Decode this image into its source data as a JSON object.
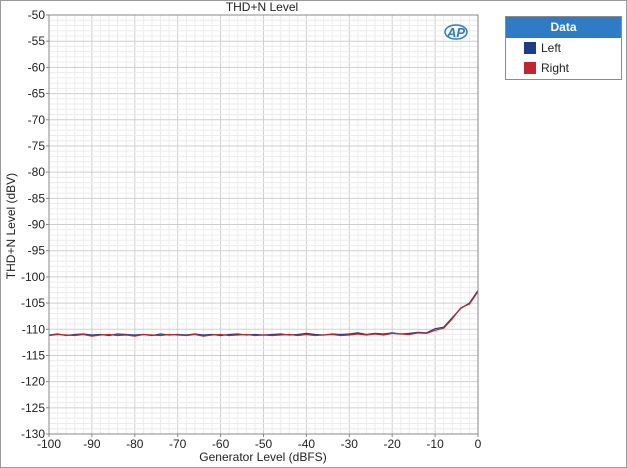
{
  "chart_data": {
    "type": "line",
    "title": "THD+N Level",
    "xlabel": "Generator Level (dBFS)",
    "ylabel": "THD+N Level (dBV)",
    "xlim": [
      -100,
      0
    ],
    "ylim": [
      -130,
      -50
    ],
    "xticks": [
      -100,
      -90,
      -80,
      -70,
      -60,
      -50,
      -40,
      -30,
      -20,
      -10,
      0
    ],
    "yticks": [
      -50,
      -55,
      -60,
      -65,
      -70,
      -75,
      -80,
      -85,
      -90,
      -95,
      -100,
      -105,
      -110,
      -115,
      -120,
      -125,
      -130
    ],
    "grid": true,
    "legend": {
      "title": "Data",
      "placement": "right"
    },
    "logo": "AP",
    "series": [
      {
        "name": "Left",
        "color": "#1f3c88",
        "x": [
          -100,
          -98,
          -96,
          -94,
          -92,
          -90,
          -88,
          -86,
          -84,
          -82,
          -80,
          -78,
          -76,
          -74,
          -72,
          -70,
          -68,
          -66,
          -64,
          -62,
          -60,
          -58,
          -56,
          -54,
          -52,
          -50,
          -48,
          -46,
          -44,
          -42,
          -40,
          -38,
          -36,
          -34,
          -32,
          -30,
          -28,
          -26,
          -24,
          -22,
          -20,
          -18,
          -16,
          -14,
          -12,
          -10,
          -8,
          -6,
          -4,
          -2,
          0
        ],
        "y": [
          -111.1,
          -110.9,
          -111.2,
          -111.0,
          -110.9,
          -111.1,
          -111.0,
          -111.2,
          -110.9,
          -111.0,
          -111.1,
          -111.0,
          -111.2,
          -110.9,
          -111.1,
          -111.0,
          -111.1,
          -110.9,
          -111.1,
          -111.0,
          -111.2,
          -111.0,
          -110.9,
          -111.1,
          -111.0,
          -111.1,
          -111.0,
          -110.9,
          -111.1,
          -111.0,
          -110.8,
          -111.0,
          -111.1,
          -110.9,
          -111.0,
          -110.9,
          -110.7,
          -111.0,
          -110.8,
          -110.9,
          -110.7,
          -110.9,
          -110.8,
          -110.6,
          -110.7,
          -109.9,
          -109.6,
          -107.8,
          -106.0,
          -105.0,
          -102.6
        ]
      },
      {
        "name": "Right",
        "color": "#c0262d",
        "x": [
          -100,
          -98,
          -96,
          -94,
          -92,
          -90,
          -88,
          -86,
          -84,
          -82,
          -80,
          -78,
          -76,
          -74,
          -72,
          -70,
          -68,
          -66,
          -64,
          -62,
          -60,
          -58,
          -56,
          -54,
          -52,
          -50,
          -48,
          -46,
          -44,
          -42,
          -40,
          -38,
          -36,
          -34,
          -32,
          -30,
          -28,
          -26,
          -24,
          -22,
          -20,
          -18,
          -16,
          -14,
          -12,
          -10,
          -8,
          -6,
          -4,
          -2,
          0
        ],
        "y": [
          -111.2,
          -111.0,
          -111.1,
          -111.2,
          -111.0,
          -111.3,
          -111.1,
          -111.0,
          -111.2,
          -111.1,
          -111.3,
          -111.0,
          -111.1,
          -111.2,
          -111.0,
          -111.1,
          -111.2,
          -111.0,
          -111.3,
          -111.1,
          -111.0,
          -111.2,
          -111.1,
          -111.0,
          -111.2,
          -111.1,
          -111.2,
          -111.1,
          -111.0,
          -111.2,
          -111.0,
          -111.2,
          -111.1,
          -111.0,
          -111.2,
          -111.1,
          -110.9,
          -111.1,
          -110.9,
          -111.1,
          -110.8,
          -110.9,
          -111.0,
          -110.7,
          -110.8,
          -110.2,
          -109.8,
          -108.0,
          -105.9,
          -105.2,
          -102.8
        ]
      }
    ]
  }
}
